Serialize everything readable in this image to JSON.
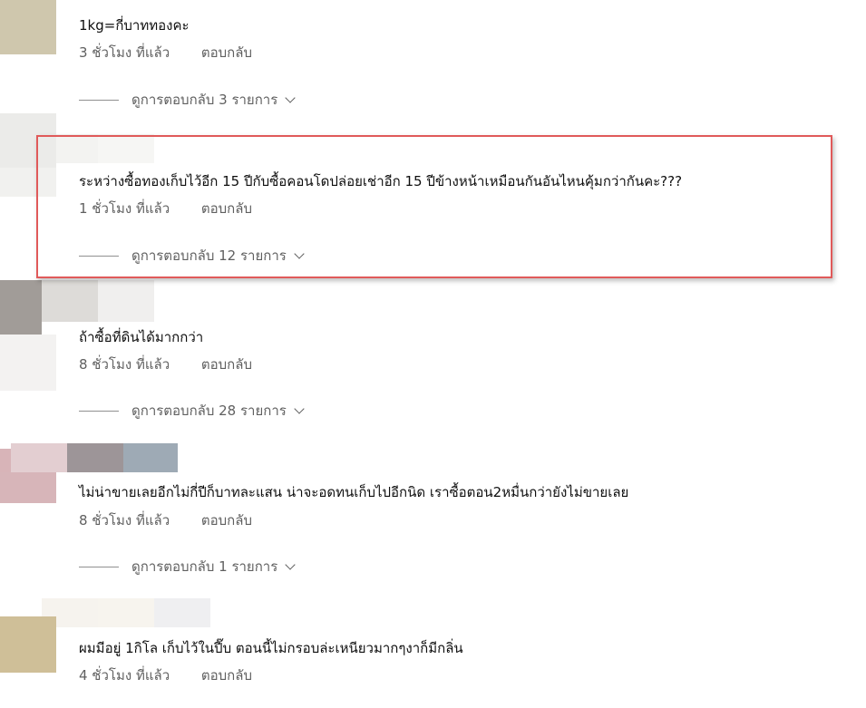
{
  "comments": [
    {
      "text": "1kg=กี่บาททองคะ",
      "time": "3 ชั่วโมง ที่แล้ว",
      "reply": "ตอบกลับ",
      "view_replies": "ดูการตอบกลับ 3 รายการ"
    },
    {
      "text": "ระหว่างซื้อทองเก็บไว้อีก 15 ปีกับซื้อคอนโดปล่อยเช่าอีก 15 ปีข้างหน้าเหมือนกันอันไหนคุ้มกว่ากันคะ???",
      "time": "1 ชั่วโมง ที่แล้ว",
      "reply": "ตอบกลับ",
      "view_replies": "ดูการตอบกลับ 12 รายการ"
    },
    {
      "text": "ถ้าซื้อที่ดินได้มากกว่า",
      "time": "8 ชั่วโมง ที่แล้ว",
      "reply": "ตอบกลับ",
      "view_replies": "ดูการตอบกลับ 28 รายการ"
    },
    {
      "text": "ไม่น่าขายเลยอีกไม่กี่ปีก็บาทละแสน น่าจะอดทนเก็บไปอีกนิด เราซื้อตอน2หมื่นกว่ายังไม่ขายเลย",
      "time": "8 ชั่วโมง ที่แล้ว",
      "reply": "ตอบกลับ",
      "view_replies": "ดูการตอบกลับ 1 รายการ"
    },
    {
      "text": "ผมมีอยู่ 1กิโล เก็บไว้ในปี๊บ ตอนนี้ไม่กรอบล่ะเหนียวมากๆงาก็มีกลิ่น",
      "time": "4 ชั่วโมง ที่แล้ว",
      "reply": "ตอบกลับ"
    }
  ],
  "colors": {
    "highlight_border": "#e05a5a",
    "meta_text": "#606060",
    "body_text": "#0f0f0f"
  }
}
